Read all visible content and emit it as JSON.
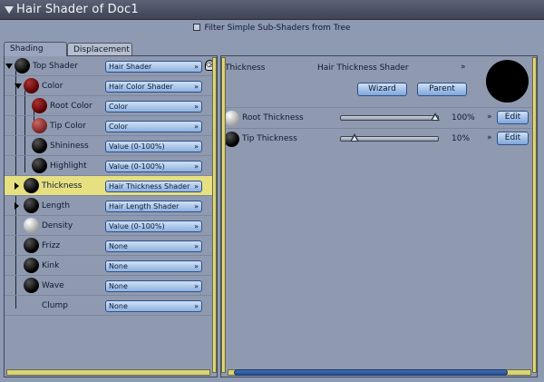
{
  "window": {
    "title": "Hair Shader of Doc1"
  },
  "filter_label": "Filter Simple Sub-Shaders from Tree",
  "tabs": [
    {
      "label": "Shading"
    },
    {
      "label": "Displacement"
    }
  ],
  "tree": [
    {
      "label": "Top Shader",
      "value": "Hair Shader"
    },
    {
      "label": "Color",
      "value": "Hair Color Shader"
    },
    {
      "label": "Root Color",
      "value": "Color"
    },
    {
      "label": "Tip Color",
      "value": "Color"
    },
    {
      "label": "Shininess",
      "value": "Value (0-100%)"
    },
    {
      "label": "Highlight",
      "value": "Value (0-100%)"
    },
    {
      "label": "Thickness",
      "value": "Hair Thickness Shader"
    },
    {
      "label": "Length",
      "value": "Hair Length Shader"
    },
    {
      "label": "Density",
      "value": "Value (0-100%)"
    },
    {
      "label": "Frizz",
      "value": "None"
    },
    {
      "label": "Kink",
      "value": "None"
    },
    {
      "label": "Wave",
      "value": "None"
    },
    {
      "label": "Clump",
      "value": "None"
    }
  ],
  "detail": {
    "name": "Thickness",
    "shader": "Hair Thickness Shader",
    "buttons": {
      "wizard": "Wizard",
      "parent": "Parent"
    },
    "params": [
      {
        "label": "Root Thickness",
        "value": "100%",
        "fraction": 1.0,
        "edit": "Edit"
      },
      {
        "label": "Tip Thickness",
        "value": "10%",
        "fraction": 0.1,
        "edit": "Edit"
      }
    ]
  },
  "icons": {
    "chevron": "»",
    "trash": "trash-icon"
  }
}
